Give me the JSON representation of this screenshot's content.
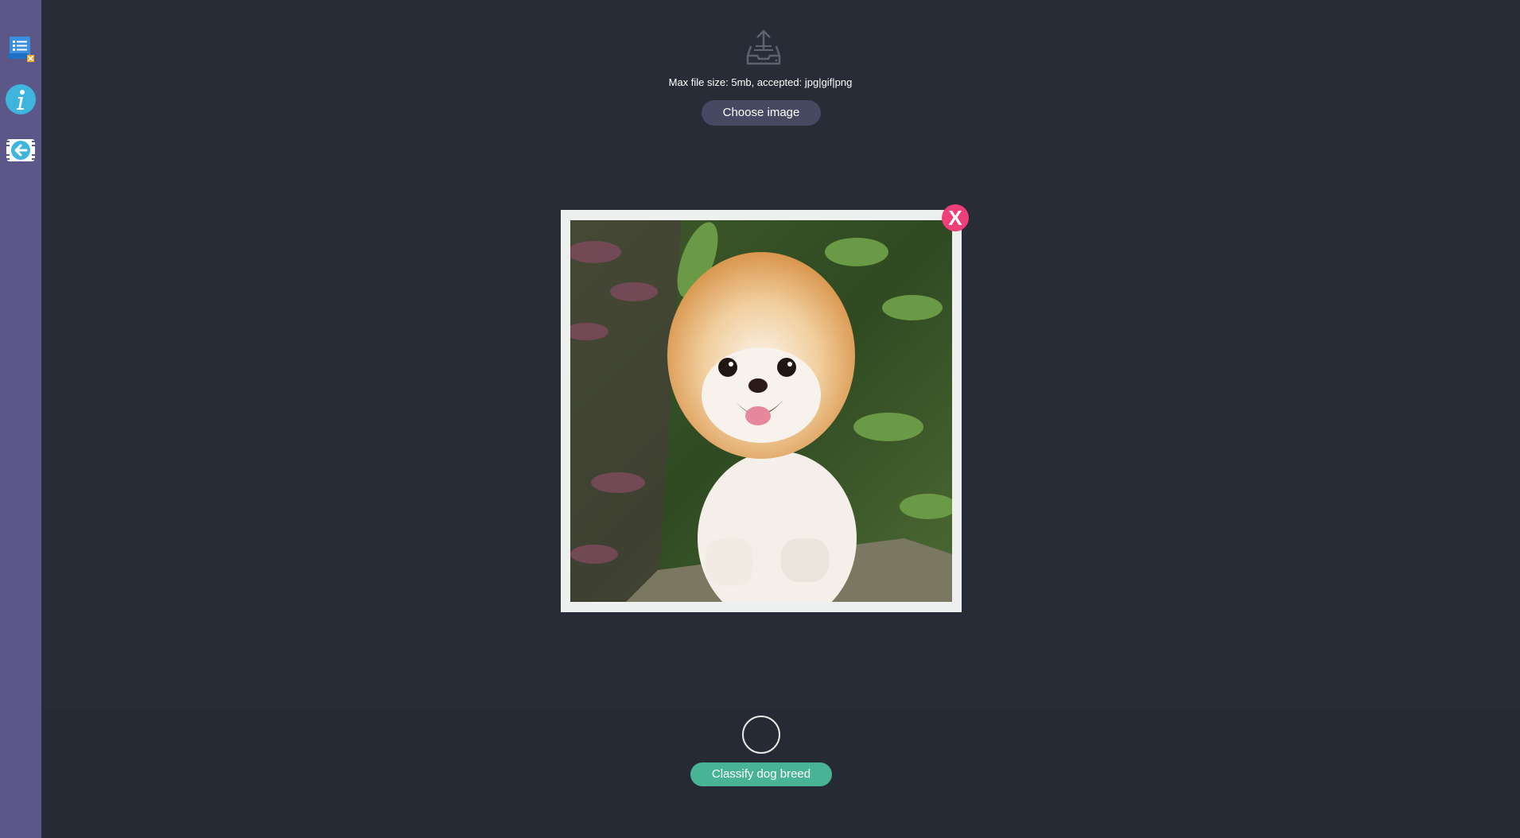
{
  "sidebar": {
    "items": [
      {
        "name": "history",
        "icon": "list-document-icon"
      },
      {
        "name": "about",
        "icon": "info-icon"
      },
      {
        "name": "back",
        "icon": "back-arrow-icon"
      }
    ]
  },
  "upload": {
    "icon": "upload-tray-icon",
    "hint": "Max file size: 5mb, accepted: jpg|gif|png",
    "choose_label": "Choose image"
  },
  "preview": {
    "remove_label": "X",
    "image": "uploaded-dog-photo"
  },
  "actions": {
    "classify_label": "Classify dog breed"
  },
  "colors": {
    "background": "#282c36",
    "sidebar": "#5b5889",
    "choose_button": "#474963",
    "remove_button": "#ef3f78",
    "classify_button": "#48b495"
  }
}
